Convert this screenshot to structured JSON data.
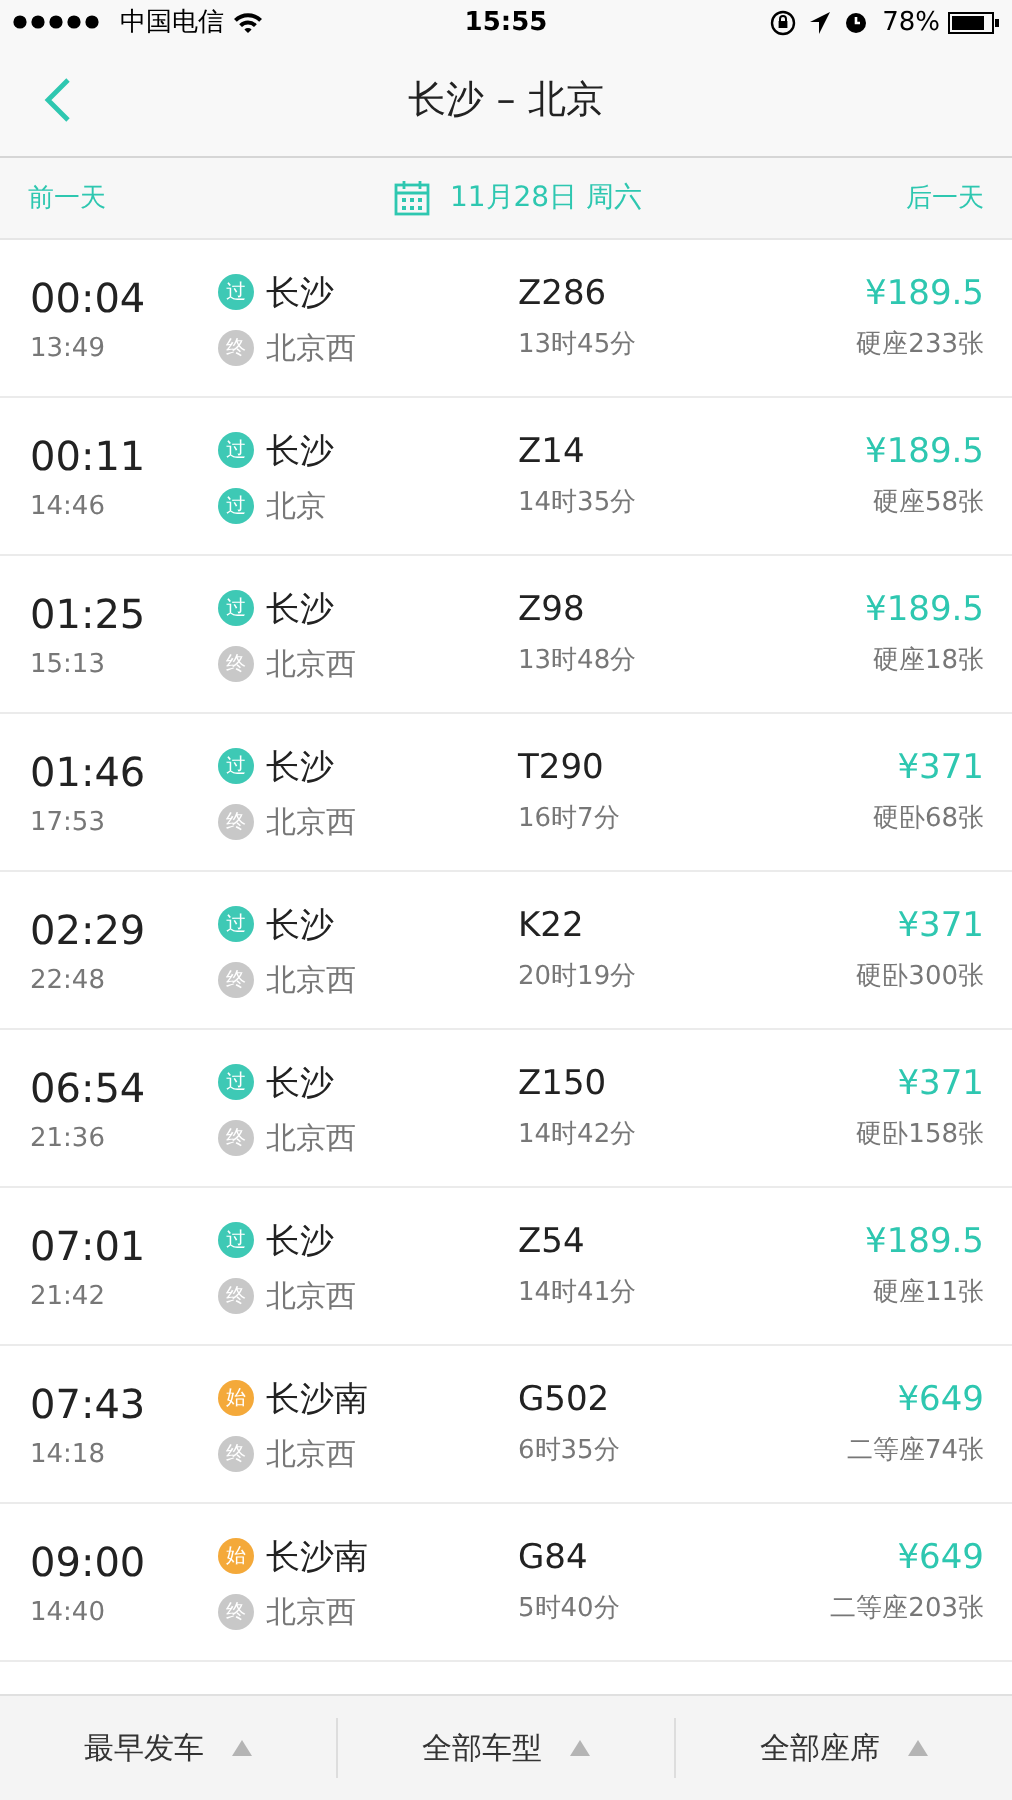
{
  "status_bar": {
    "carrier": "中国电信",
    "time": "15:55",
    "battery": "78%"
  },
  "nav": {
    "title": "长沙 – 北京"
  },
  "date_bar": {
    "prev": "前一天",
    "date": "11月28日 周六",
    "next": "后一天"
  },
  "trains": [
    {
      "depart": "00:04",
      "arrive": "13:49",
      "from": {
        "kind": "pass",
        "badge": "过",
        "name": "长沙"
      },
      "to": {
        "kind": "end",
        "badge": "终",
        "name": "北京西"
      },
      "number": "Z286",
      "duration": "13时45分",
      "price": "¥189.5",
      "seats": "硬座233张"
    },
    {
      "depart": "00:11",
      "arrive": "14:46",
      "from": {
        "kind": "pass",
        "badge": "过",
        "name": "长沙"
      },
      "to": {
        "kind": "pass",
        "badge": "过",
        "name": "北京"
      },
      "number": "Z14",
      "duration": "14时35分",
      "price": "¥189.5",
      "seats": "硬座58张"
    },
    {
      "depart": "01:25",
      "arrive": "15:13",
      "from": {
        "kind": "pass",
        "badge": "过",
        "name": "长沙"
      },
      "to": {
        "kind": "end",
        "badge": "终",
        "name": "北京西"
      },
      "number": "Z98",
      "duration": "13时48分",
      "price": "¥189.5",
      "seats": "硬座18张"
    },
    {
      "depart": "01:46",
      "arrive": "17:53",
      "from": {
        "kind": "pass",
        "badge": "过",
        "name": "长沙"
      },
      "to": {
        "kind": "end",
        "badge": "终",
        "name": "北京西"
      },
      "number": "T290",
      "duration": "16时7分",
      "price": "¥371",
      "seats": "硬卧68张"
    },
    {
      "depart": "02:29",
      "arrive": "22:48",
      "from": {
        "kind": "pass",
        "badge": "过",
        "name": "长沙"
      },
      "to": {
        "kind": "end",
        "badge": "终",
        "name": "北京西"
      },
      "number": "K22",
      "duration": "20时19分",
      "price": "¥371",
      "seats": "硬卧300张"
    },
    {
      "depart": "06:54",
      "arrive": "21:36",
      "from": {
        "kind": "pass",
        "badge": "过",
        "name": "长沙"
      },
      "to": {
        "kind": "end",
        "badge": "终",
        "name": "北京西"
      },
      "number": "Z150",
      "duration": "14时42分",
      "price": "¥371",
      "seats": "硬卧158张"
    },
    {
      "depart": "07:01",
      "arrive": "21:42",
      "from": {
        "kind": "pass",
        "badge": "过",
        "name": "长沙"
      },
      "to": {
        "kind": "end",
        "badge": "终",
        "name": "北京西"
      },
      "number": "Z54",
      "duration": "14时41分",
      "price": "¥189.5",
      "seats": "硬座11张"
    },
    {
      "depart": "07:43",
      "arrive": "14:18",
      "from": {
        "kind": "start",
        "badge": "始",
        "name": "长沙南"
      },
      "to": {
        "kind": "end",
        "badge": "终",
        "name": "北京西"
      },
      "number": "G502",
      "duration": "6时35分",
      "price": "¥649",
      "seats": "二等座74张"
    },
    {
      "depart": "09:00",
      "arrive": "14:40",
      "from": {
        "kind": "start",
        "badge": "始",
        "name": "长沙南"
      },
      "to": {
        "kind": "end",
        "badge": "终",
        "name": "北京西"
      },
      "number": "G84",
      "duration": "5时40分",
      "price": "¥649",
      "seats": "二等座203张"
    }
  ],
  "filters": [
    {
      "label": "最早发车"
    },
    {
      "label": "全部车型"
    },
    {
      "label": "全部座席"
    }
  ]
}
